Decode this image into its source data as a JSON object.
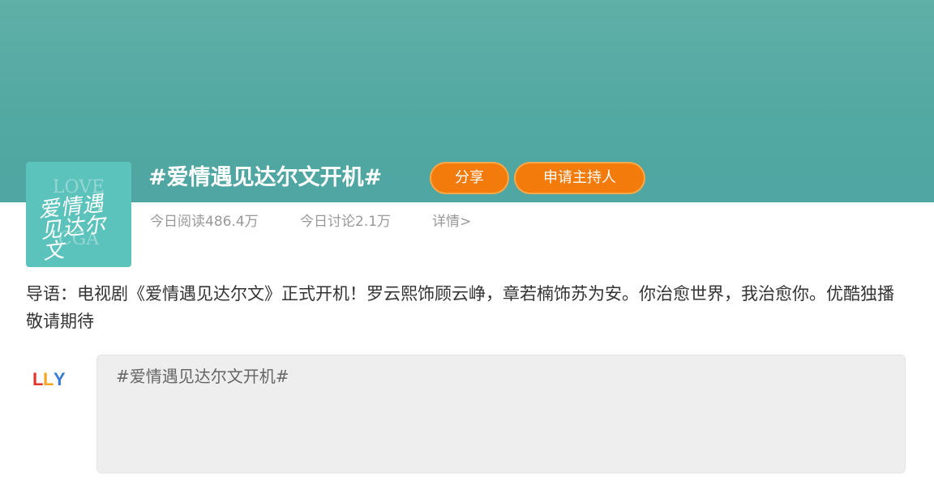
{
  "topic": {
    "title": "#爱情遇见达尔文开机#",
    "share_label": "分享",
    "apply_host_label": "申请主持人"
  },
  "avatar": {
    "text_top": "LOVE",
    "script_text": "爱情遇见达尔文",
    "text_bottom": "CGA"
  },
  "stats": {
    "reads_label": "今日阅读",
    "reads_value": "486.4万",
    "discuss_label": "今日讨论",
    "discuss_value": "2.1万",
    "detail_label": "详情>"
  },
  "intro": "导语：电视剧《爱情遇见达尔文》正式开机！罗云熙饰顾云峥，章若楠饰苏为安。你治愈世界，我治愈你。优酷独播敬请期待",
  "poster_logo": {
    "text": "LLY",
    "colors": [
      "#e8332a",
      "#f6a623",
      "#3a7bd5"
    ]
  },
  "composer": {
    "text": "#爱情遇见达尔文开机#"
  },
  "colors": {
    "banner": "#52a8a2",
    "button": "#f27b0c",
    "avatar_bg": "#5cc2bc"
  }
}
